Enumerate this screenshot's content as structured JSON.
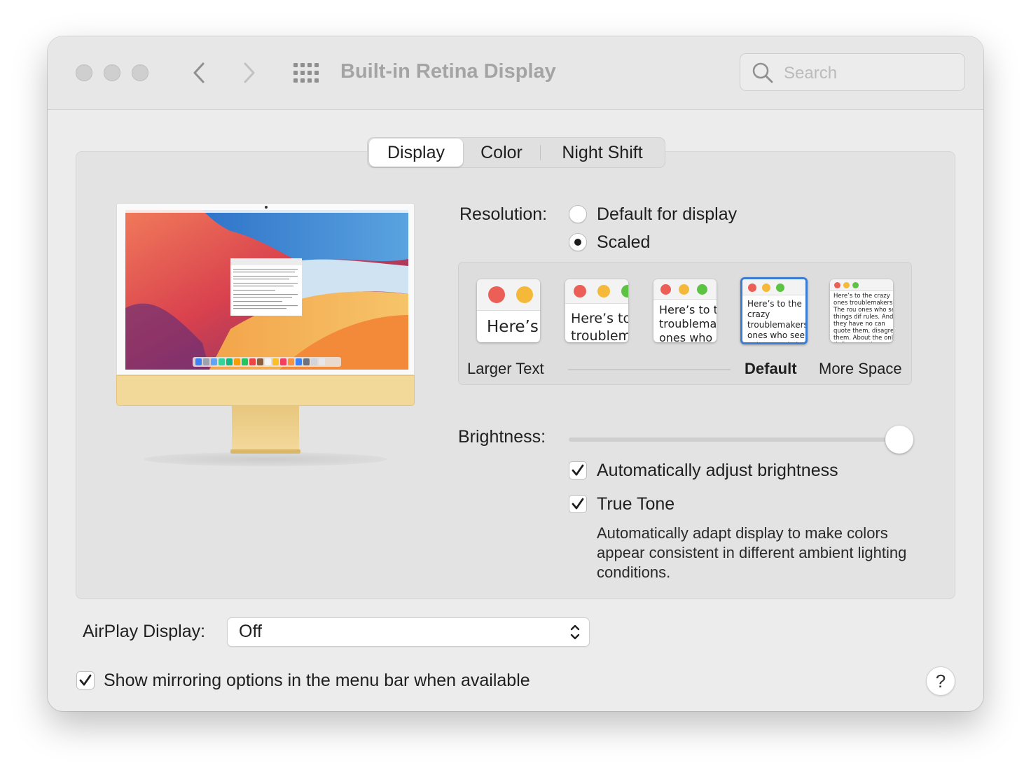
{
  "window": {
    "title": "Built-in Retina Display",
    "search_placeholder": "Search"
  },
  "tabs": [
    {
      "label": "Display",
      "active": true
    },
    {
      "label": "Color",
      "active": false
    },
    {
      "label": "Night Shift",
      "active": false
    }
  ],
  "resolution": {
    "label": "Resolution:",
    "options": [
      {
        "label": "Default for display",
        "selected": false
      },
      {
        "label": "Scaled",
        "selected": true
      }
    ],
    "scales": [
      {
        "preview_text": "Here’s"
      },
      {
        "preview_text": "Here’s to troublem"
      },
      {
        "preview_text": "Here’s to the troublema ones who"
      },
      {
        "preview_text": "Here’s to the crazy troublemakers. ones who see t rules. And they"
      },
      {
        "preview_text": "Here’s to the crazy ones troublemakers. The rou ones who see things dif rules. And they have no can quote them, disagre them. About the only th Because they change t"
      }
    ],
    "scale_labels": {
      "larger": "Larger Text",
      "default": "Default",
      "more": "More Space"
    },
    "selected_scale_index": 3
  },
  "brightness": {
    "label": "Brightness:",
    "value": 0.97,
    "auto_adjust": {
      "label": "Automatically adjust brightness",
      "checked": true
    },
    "true_tone": {
      "label": "True Tone",
      "checked": true
    },
    "true_tone_description": "Automatically adapt display to make colors appear consistent in different ambient lighting conditions."
  },
  "airplay": {
    "label": "AirPlay Display:",
    "value": "Off"
  },
  "mirroring": {
    "label": "Show mirroring options in the menu bar when available",
    "checked": true
  },
  "help": {
    "label": "?"
  },
  "colors": {
    "accent": "#3a7bd5",
    "close": "#ec5f57",
    "minimize": "#f5b93a",
    "zoom": "#5cc343",
    "imac_yellow": "#f2d999"
  }
}
